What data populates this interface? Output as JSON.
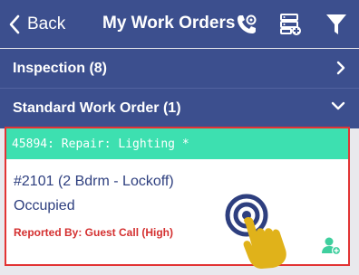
{
  "header": {
    "back_label": "Back",
    "title": "My Work Orders",
    "icons": [
      "chevron-left-icon",
      "phone-settings-icon",
      "server-add-icon",
      "filter-icon"
    ]
  },
  "sections": [
    {
      "label": "Inspection (8)",
      "state": "collapsed",
      "chevron": "chevron-right-icon"
    },
    {
      "label": "Standard Work Order (1)",
      "state": "expanded",
      "chevron": "chevron-down-icon"
    }
  ],
  "work_order": {
    "summary": "45894: Repair: Lighting *",
    "unit": "#2101 (2 Bdrm - Lockoff)",
    "status": "Occupied",
    "reported": "Reported By: Guest Call  (High)",
    "action_icon": "assign-user-icon"
  },
  "colors": {
    "header_bg": "#3c4f8e",
    "strip": "#3de0b0",
    "card_border": "#e23434",
    "unit_text": "#2e3f7f",
    "reported_text": "#d43030",
    "assign_icon": "#3fcf9e",
    "touch_hand": "#e0b21a"
  }
}
